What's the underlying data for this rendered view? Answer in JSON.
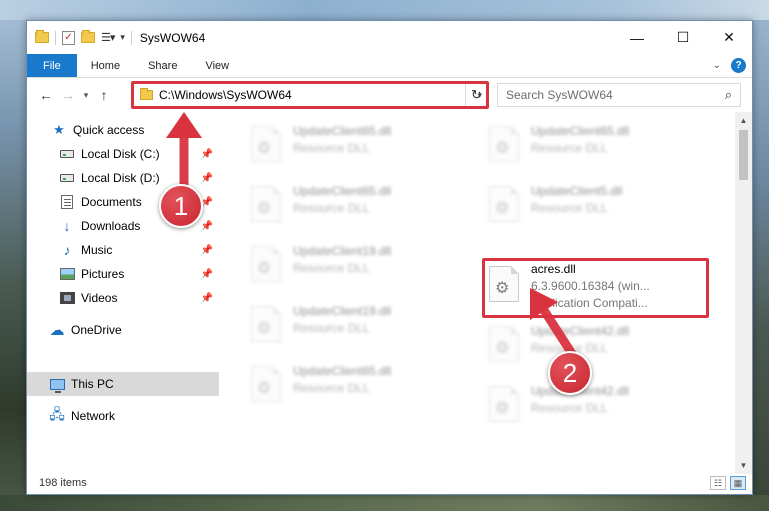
{
  "window": {
    "title": "SysWOW64",
    "controls": {
      "minimize": "—",
      "maximize": "☐",
      "close": "✕"
    }
  },
  "ribbon": {
    "tabs": [
      "File",
      "Home",
      "Share",
      "View"
    ],
    "help": "?"
  },
  "address": {
    "path": "C:\\Windows\\SysWOW64",
    "search_placeholder": "Search SysWOW64"
  },
  "sidebar": {
    "items": [
      {
        "label": "Quick access",
        "icon": "star-icon"
      },
      {
        "label": "Local Disk (C:)",
        "icon": "drive-icon",
        "pinned": true
      },
      {
        "label": "Local Disk (D:)",
        "icon": "drive-icon",
        "pinned": true
      },
      {
        "label": "Documents",
        "icon": "documents-icon",
        "pinned": true
      },
      {
        "label": "Downloads",
        "icon": "download-icon",
        "pinned": true
      },
      {
        "label": "Music",
        "icon": "music-icon",
        "pinned": true
      },
      {
        "label": "Pictures",
        "icon": "pictures-icon",
        "pinned": true
      },
      {
        "label": "Videos",
        "icon": "videos-icon",
        "pinned": true
      },
      {
        "label": "OneDrive",
        "icon": "cloud-icon"
      },
      {
        "label": "This PC",
        "icon": "computer-icon",
        "selected": true
      },
      {
        "label": "Network",
        "icon": "network-icon"
      }
    ]
  },
  "files": {
    "left": [
      {
        "name": "UpdateClient65.dll",
        "type": "Resource DLL"
      },
      {
        "name": "UpdateClient65.dll",
        "type": "Resource DLL"
      },
      {
        "name": "UpdateClient19.dll",
        "type": "Resource DLL"
      },
      {
        "name": "UpdateClient19.dll",
        "type": "Resource DLL"
      },
      {
        "name": "UpdateClient65.dll",
        "type": "Resource DLL"
      }
    ],
    "right": [
      {
        "name": "UpdateClient65.dll",
        "type": "Resource DLL"
      },
      {
        "name": "UpdateClient5.dll",
        "type": "Resource DLL"
      },
      {
        "name": "acres.dll",
        "version": "6.3.9600.16384 (win...",
        "desc": "Application Compati..."
      },
      {
        "name": "UpdateClient42.dll",
        "type": "Resource DLL"
      },
      {
        "name": "UpdateClient42.dll",
        "type": "Resource DLL"
      }
    ]
  },
  "status": {
    "item_count": "198 items"
  },
  "callouts": {
    "one": "1",
    "two": "2"
  },
  "colors": {
    "accent": "#1979ca",
    "highlight": "#d9333f",
    "selection": "#d9d9d9"
  }
}
